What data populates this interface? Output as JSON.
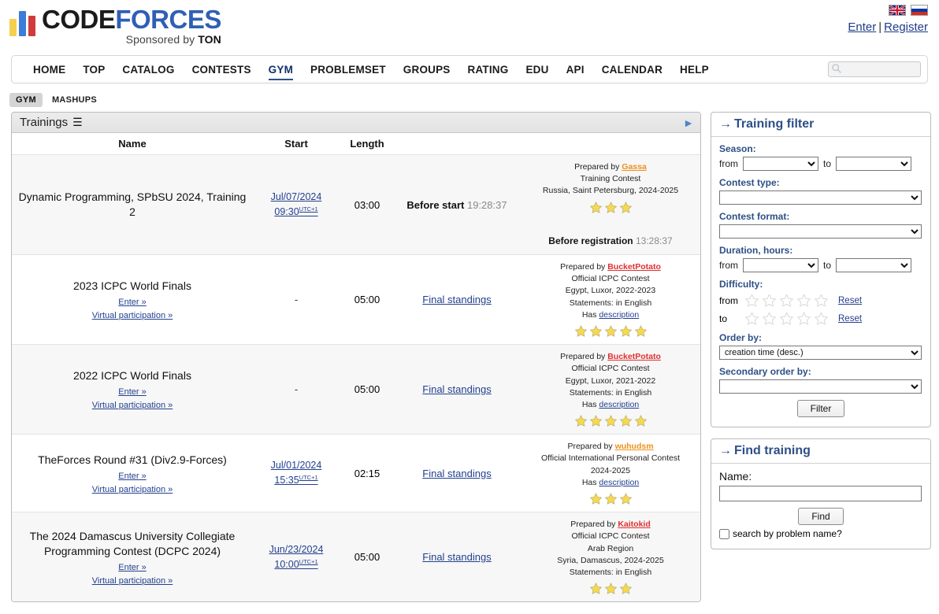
{
  "header": {
    "logo": {
      "code": "CODE",
      "forces": "FORCES",
      "sponsor_prefix": "Sponsored by ",
      "sponsor_name": "TON"
    },
    "flags": [
      "united-kingdom-flag",
      "russia-flag"
    ],
    "enter_label": "Enter",
    "separator": "|",
    "register_label": "Register"
  },
  "nav": {
    "items": [
      {
        "label": "HOME",
        "active": false
      },
      {
        "label": "TOP",
        "active": false
      },
      {
        "label": "CATALOG",
        "active": false
      },
      {
        "label": "CONTESTS",
        "active": false
      },
      {
        "label": "GYM",
        "active": true
      },
      {
        "label": "PROBLEMSET",
        "active": false
      },
      {
        "label": "GROUPS",
        "active": false
      },
      {
        "label": "RATING",
        "active": false
      },
      {
        "label": "EDU",
        "active": false
      },
      {
        "label": "API",
        "active": false
      },
      {
        "label": "CALENDAR",
        "active": false
      },
      {
        "label": "HELP",
        "active": false
      }
    ],
    "search": {
      "value": "",
      "placeholder": ""
    }
  },
  "subtabs": [
    {
      "label": "GYM",
      "active": true
    },
    {
      "label": "MASHUPS",
      "active": false
    }
  ],
  "table": {
    "caption": "Trainings",
    "caption_icon": "list-icon",
    "next_page_icon": "play-right-icon",
    "columns": [
      "Name",
      "Start",
      "Length",
      "",
      ""
    ],
    "rows": [
      {
        "name": "Dynamic Programming, SPbSU 2024, Training 2",
        "links": [],
        "start_date": "Jul/07/2024",
        "start_time": "09:30",
        "start_tz": "UTC+1",
        "start_dash": null,
        "length": "03:00",
        "status_type": "countdown",
        "status_label": "Before start",
        "status_value": "19:28:37",
        "status_link": null,
        "prepared_by_label": "Prepared by",
        "author": "Gassa",
        "author_color": "orange",
        "info_lines": [
          "Training Contest",
          "Russia, Saint Petersburg, 2024-2025"
        ],
        "has_description": false,
        "description_prefix": "Has",
        "description_label": "description",
        "stars": 3,
        "registration_label": "Before registration",
        "registration_value": "13:28:37"
      },
      {
        "name": "2023 ICPC World Finals",
        "links": [
          "Enter »",
          "Virtual participation »"
        ],
        "start_date": null,
        "start_time": null,
        "start_tz": null,
        "start_dash": "-",
        "length": "05:00",
        "status_type": "link",
        "status_label": null,
        "status_value": null,
        "status_link": "Final standings",
        "prepared_by_label": "Prepared by",
        "author": "BucketPotato",
        "author_color": "red",
        "info_lines": [
          "Official ICPC Contest",
          "Egypt, Luxor, 2022-2023",
          "Statements: in English"
        ],
        "has_description": true,
        "description_prefix": "Has",
        "description_label": "description",
        "stars": 5,
        "registration_label": null,
        "registration_value": null
      },
      {
        "name": "2022 ICPC World Finals",
        "links": [
          "Enter »",
          "Virtual participation »"
        ],
        "start_date": null,
        "start_time": null,
        "start_tz": null,
        "start_dash": "-",
        "length": "05:00",
        "status_type": "link",
        "status_label": null,
        "status_value": null,
        "status_link": "Final standings",
        "prepared_by_label": "Prepared by",
        "author": "BucketPotato",
        "author_color": "red",
        "info_lines": [
          "Official ICPC Contest",
          "Egypt, Luxor, 2021-2022",
          "Statements: in English"
        ],
        "has_description": true,
        "description_prefix": "Has",
        "description_label": "description",
        "stars": 5,
        "registration_label": null,
        "registration_value": null
      },
      {
        "name": "TheForces Round #31 (Div2.9-Forces)",
        "links": [
          "Enter »",
          "Virtual participation »"
        ],
        "start_date": "Jul/01/2024",
        "start_time": "15:35",
        "start_tz": "UTC+1",
        "start_dash": null,
        "length": "02:15",
        "status_type": "link",
        "status_label": null,
        "status_value": null,
        "status_link": "Final standings",
        "prepared_by_label": "Prepared by",
        "author": "wuhudsm",
        "author_color": "orange",
        "info_lines": [
          "Official International Personal Contest",
          "2024-2025"
        ],
        "has_description": true,
        "description_prefix": "Has",
        "description_label": "description",
        "stars": 3,
        "registration_label": null,
        "registration_value": null
      },
      {
        "name": "The 2024 Damascus University Collegiate Programming Contest (DCPC 2024)",
        "links": [
          "Enter »",
          "Virtual participation »"
        ],
        "start_date": "Jun/23/2024",
        "start_time": "10:00",
        "start_tz": "UTC+1",
        "start_dash": null,
        "length": "05:00",
        "status_type": "link",
        "status_label": null,
        "status_value": null,
        "status_link": "Final standings",
        "prepared_by_label": "Prepared by",
        "author": "Kaitokid",
        "author_color": "red",
        "info_lines": [
          "Official ICPC Contest",
          "Arab Region",
          "Syria, Damascus, 2024-2025",
          "Statements: in English"
        ],
        "has_description": false,
        "description_prefix": "Has",
        "description_label": "description",
        "stars": 3,
        "registration_label": null,
        "registration_value": null
      }
    ]
  },
  "filter": {
    "title": "Training filter",
    "arrow": "→",
    "season_label": "Season:",
    "from_label": "from",
    "to_label": "to",
    "season_from": "",
    "season_to": "",
    "contest_type_label": "Contest type:",
    "contest_type": "",
    "contest_format_label": "Contest format:",
    "contest_format": "",
    "duration_label": "Duration, hours:",
    "duration_from": "",
    "duration_to": "",
    "difficulty_label": "Difficulty:",
    "difficulty_from_stars": 0,
    "difficulty_to_stars": 0,
    "reset_label": "Reset",
    "order_by_label": "Order by:",
    "order_by": "creation time (desc.)",
    "secondary_order_label": "Secondary order by:",
    "secondary_order": "",
    "filter_button": "Filter"
  },
  "find": {
    "title": "Find training",
    "arrow": "→",
    "name_label": "Name:",
    "name_value": "",
    "find_button": "Find",
    "checkbox_label": "search by problem name?",
    "checkbox_checked": false
  },
  "colors": {
    "link": "#23408e",
    "heading": "#2d4f86",
    "red_user": "#e03030",
    "orange_user": "#f0901a",
    "star_gold": "#f5d24e"
  }
}
